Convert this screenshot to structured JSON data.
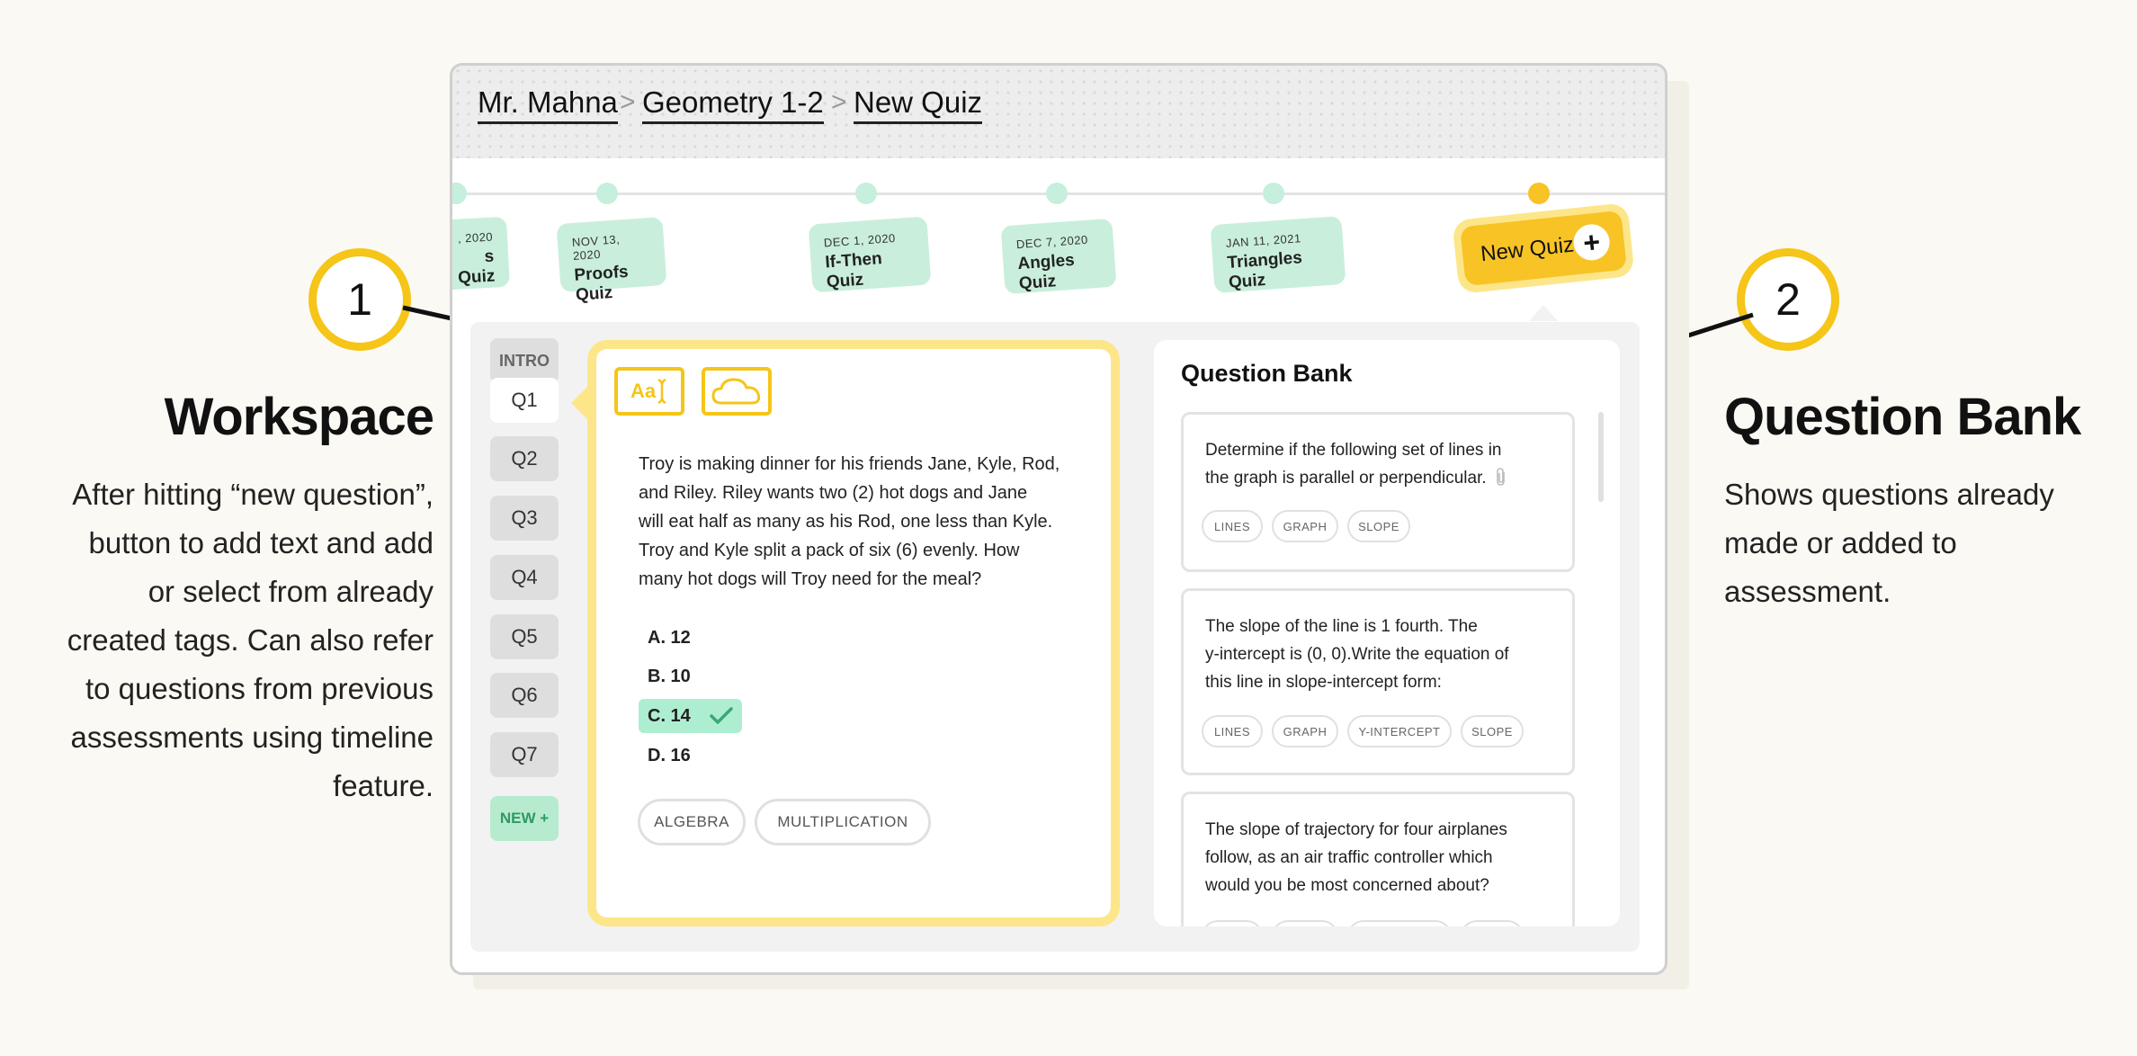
{
  "annotations": {
    "one": {
      "number": "1",
      "title": "Workspace",
      "desc": [
        "After hitting “new question”,",
        "button to add text and add",
        "or select from already",
        "created tags. Can also refer",
        "to questions from previous",
        "assessments using timeline",
        "feature."
      ]
    },
    "two": {
      "number": "2",
      "title": "Question Bank",
      "desc": [
        "Shows questions already",
        "made or added to",
        "assessment."
      ]
    }
  },
  "breadcrumb": {
    "teacher": "Mr. Mahna",
    "course": "Geometry 1-2",
    "page": "New Quiz",
    "separator": ">"
  },
  "timeline": {
    "items": [
      {
        "date": ", 2020",
        "name": "s Quiz"
      },
      {
        "date": "NOV 13, 2020",
        "name": "Proofs Quiz"
      },
      {
        "date": "DEC 1, 2020",
        "name": "If-Then Quiz"
      },
      {
        "date": "DEC 7, 2020",
        "name": "Angles Quiz"
      },
      {
        "date": "JAN 11, 2021",
        "name": "Triangles Quiz"
      }
    ],
    "new_quiz_label": "New Quiz?",
    "new_quiz_plus": "+"
  },
  "question_tabs": [
    "INTRO",
    "Q1",
    "Q2",
    "Q3",
    "Q4",
    "Q5",
    "Q6",
    "Q7",
    "NEW +"
  ],
  "workspace": {
    "text_tool_label": "Aa",
    "question_lines": [
      "Troy is making dinner for his friends Jane, Kyle, Rod,",
      "and Riley. Riley wants two (2) hot dogs and Jane",
      "will eat half as many as his Rod, one less than Kyle.",
      "Troy and Kyle split a pack of six (6) evenly. How",
      "many hot dogs will Troy need for the meal?"
    ],
    "answers": [
      "A. 12",
      "B. 10",
      "C. 14",
      "D. 16"
    ],
    "correct_answer": "C. 14",
    "tags": [
      "ALGEBRA",
      "MULTIPLICATION"
    ]
  },
  "question_bank": {
    "title": "Question Bank",
    "cards": [
      {
        "lines": [
          "Determine if the following set of lines in",
          "the graph is parallel or perpendicular."
        ],
        "tags": [
          "LINES",
          "GRAPH",
          "SLOPE"
        ]
      },
      {
        "lines": [
          "The slope of the line is 1 fourth. The",
          "y-intercept is (0, 0).Write the equation of",
          "this line in slope-intercept form:"
        ],
        "tags": [
          "LINES",
          "GRAPH",
          "Y-INTERCEPT",
          "SLOPE"
        ]
      },
      {
        "lines": [
          "The slope of trajectory for four airplanes",
          "follow, as an air traffic controller which",
          "would you be most concerned about?"
        ],
        "tags": []
      }
    ]
  },
  "colors": {
    "accent_yellow": "#f5c518",
    "timeline_green": "#c9efdc",
    "correct_green": "#aeeed0"
  }
}
